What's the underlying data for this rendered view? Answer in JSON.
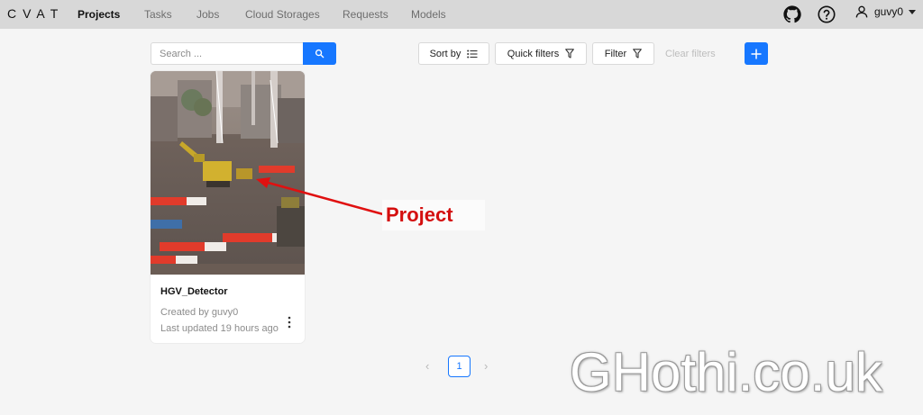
{
  "app": {
    "logo": "CVAT"
  },
  "nav": {
    "projects": "Projects",
    "tasks": "Tasks",
    "jobs": "Jobs",
    "cloud_storages": "Cloud Storages",
    "requests": "Requests",
    "models": "Models",
    "active": "Projects"
  },
  "header": {
    "user_name": "guvy0",
    "icons": [
      "github-icon",
      "help-icon",
      "user-icon",
      "caret-down-icon"
    ]
  },
  "toolbar": {
    "search_placeholder": "Search ...",
    "sort_by": "Sort by",
    "quick_filters": "Quick filters",
    "filter": "Filter",
    "clear_filters": "Clear filters"
  },
  "project_card": {
    "title": "HGV_Detector",
    "created_by": "Created by guvy0",
    "last_updated": "Last updated 19 hours ago"
  },
  "annotation": {
    "label": "Project",
    "color": "#d40f0f"
  },
  "pagination": {
    "current_page": "1",
    "prev": "‹",
    "next": "›"
  },
  "watermark": "GHothi.co.uk",
  "colors": {
    "primary": "#1677ff",
    "header_bg": "#d8d8d8",
    "page_bg": "#f5f5f5"
  }
}
